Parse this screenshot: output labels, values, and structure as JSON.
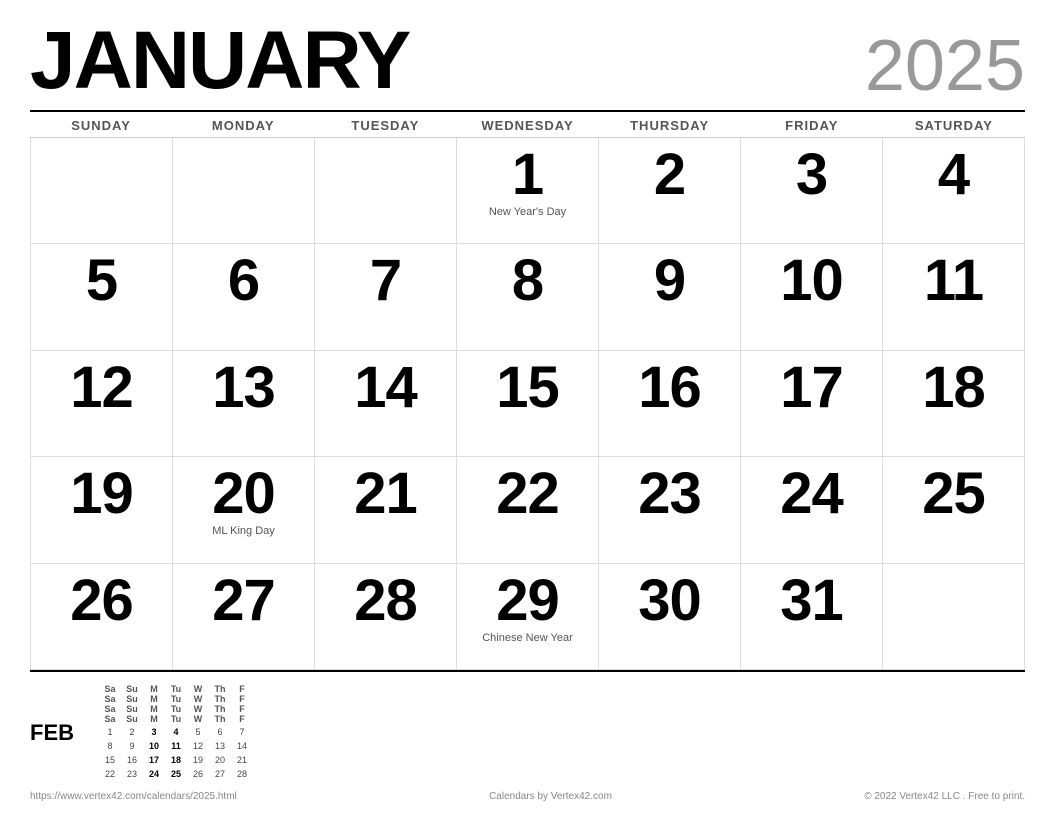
{
  "header": {
    "month": "JANUARY",
    "year": "2025"
  },
  "day_headers": [
    "SUNDAY",
    "MONDAY",
    "TUESDAY",
    "WEDNESDAY",
    "THURSDAY",
    "FRIDAY",
    "SATURDAY"
  ],
  "weeks": [
    [
      {
        "day": "",
        "holiday": ""
      },
      {
        "day": "",
        "holiday": ""
      },
      {
        "day": "",
        "holiday": ""
      },
      {
        "day": "1",
        "holiday": "New Year's Day"
      },
      {
        "day": "2",
        "holiday": ""
      },
      {
        "day": "3",
        "holiday": ""
      },
      {
        "day": "4",
        "holiday": ""
      }
    ],
    [
      {
        "day": "5",
        "holiday": ""
      },
      {
        "day": "6",
        "holiday": ""
      },
      {
        "day": "7",
        "holiday": ""
      },
      {
        "day": "8",
        "holiday": ""
      },
      {
        "day": "9",
        "holiday": ""
      },
      {
        "day": "10",
        "holiday": ""
      },
      {
        "day": "11",
        "holiday": ""
      }
    ],
    [
      {
        "day": "12",
        "holiday": ""
      },
      {
        "day": "13",
        "holiday": ""
      },
      {
        "day": "14",
        "holiday": ""
      },
      {
        "day": "15",
        "holiday": ""
      },
      {
        "day": "16",
        "holiday": ""
      },
      {
        "day": "17",
        "holiday": ""
      },
      {
        "day": "18",
        "holiday": ""
      }
    ],
    [
      {
        "day": "19",
        "holiday": ""
      },
      {
        "day": "20",
        "holiday": "ML King Day"
      },
      {
        "day": "21",
        "holiday": ""
      },
      {
        "day": "22",
        "holiday": ""
      },
      {
        "day": "23",
        "holiday": ""
      },
      {
        "day": "24",
        "holiday": ""
      },
      {
        "day": "25",
        "holiday": ""
      }
    ],
    [
      {
        "day": "26",
        "holiday": ""
      },
      {
        "day": "27",
        "holiday": ""
      },
      {
        "day": "28",
        "holiday": ""
      },
      {
        "day": "29",
        "holiday": "Chinese New Year"
      },
      {
        "day": "30",
        "holiday": ""
      },
      {
        "day": "31",
        "holiday": ""
      },
      {
        "day": "",
        "holiday": ""
      }
    ]
  ],
  "mini_cal": {
    "month_label": "FEB",
    "day_headers": [
      "Sa",
      "Su",
      "M",
      "Tu",
      "W",
      "Th",
      "F",
      "Sa",
      "Su",
      "M",
      "Tu",
      "W",
      "Th",
      "F",
      "Sa",
      "Su",
      "M",
      "Tu",
      "W",
      "Th",
      "F",
      "Sa",
      "Su",
      "M",
      "Tu",
      "W",
      "Th",
      "F"
    ],
    "days": [
      "1",
      "2",
      "3",
      "4",
      "5",
      "6",
      "7",
      "8",
      "9",
      "10",
      "11",
      "12",
      "13",
      "14",
      "15",
      "16",
      "17",
      "18",
      "19",
      "20",
      "21",
      "22",
      "23",
      "24",
      "25",
      "26",
      "27",
      "28"
    ]
  },
  "footer": {
    "left": "https://www.vertex42.com/calendars/2025.html",
    "center": "Calendars by Vertex42.com",
    "right": "© 2022 Vertex42 LLC . Free to print."
  }
}
